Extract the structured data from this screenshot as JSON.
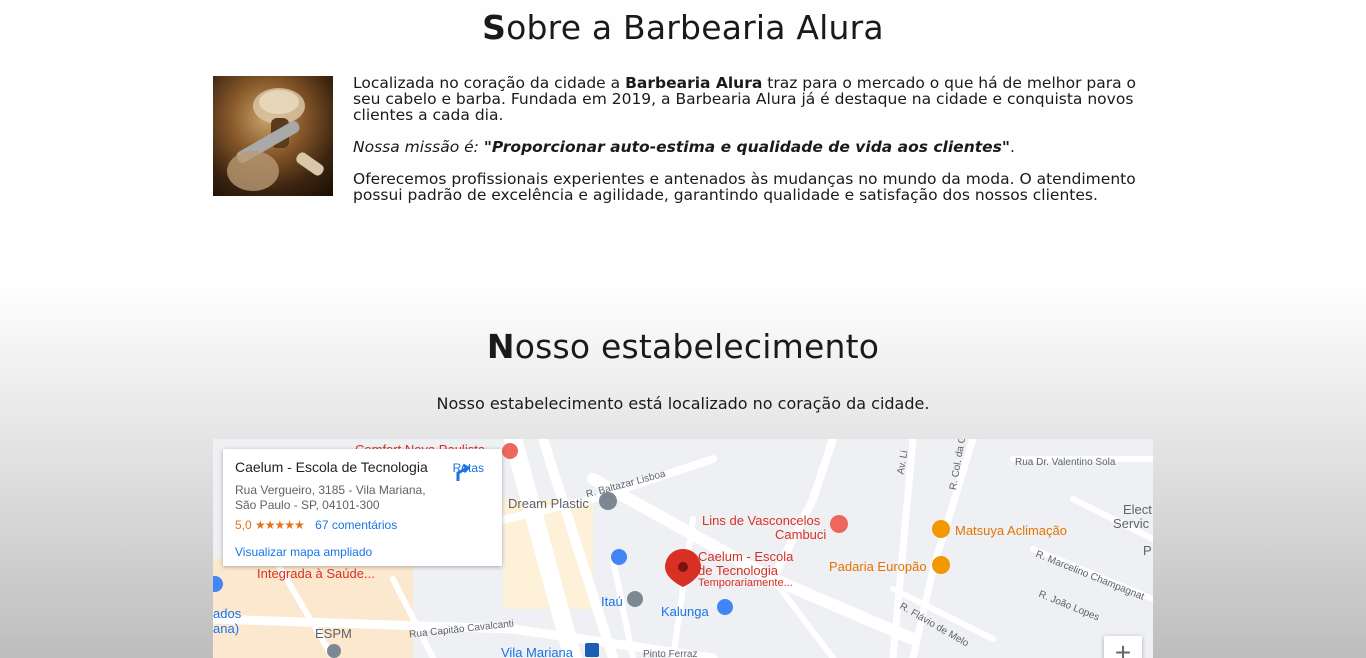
{
  "about": {
    "title_cap": "S",
    "title_rest": "obre a Barbearia Alura",
    "p1_pre": "Localizada no coração da cidade a ",
    "p1_brand": "Barbearia Alura",
    "p1_post": " traz para o mercado o que há de melhor para o seu cabelo e barba. Fundada em 2019, a Barbearia Alura já é destaque na cidade e conquista novos clientes a cada dia.",
    "mission_label": "Nossa missão é: ",
    "mission_quote": "\"Proporcionar auto-estima e qualidade de vida aos clientes\"",
    "mission_end": ".",
    "p3": "Oferecemos profissionais experientes e antenados às mudanças no mundo da moda. O atendimento possui padrão de excelência e agilidade, garantindo qualidade e satisfação dos nossos clientes."
  },
  "store": {
    "title_cap": "N",
    "title_rest": "osso estabelecimento",
    "subtitle": "Nosso estabelecimento está localizado no coração da cidade."
  },
  "map": {
    "card": {
      "name": "Caelum - Escola de Tecnologia",
      "address": "Rua Vergueiro, 3185 - Vila Mariana, São Paulo - SP, 04101-300",
      "rating": "5,0",
      "stars": "★★★★★",
      "reviews": "67 comentários",
      "link": "Visualizar mapa ampliado",
      "directions": "Rotas"
    },
    "labels": {
      "comfort": "Comfort Nova Paulista",
      "baltazar": "R. Baltazar Lisboa",
      "av": "Av. Li",
      "valentino": "Rua Dr. Valentino Sola",
      "dream": "Dream Plastic",
      "lins1": "Lins de Vasconcelos",
      "lins2": "Cambuci",
      "matsuya": "Matsuya Aclimação",
      "elect1": "Elect",
      "elect2": "Servic",
      "gloria": "R. Col. da Glória",
      "caelum1": "Caelum - Escola",
      "caelum2": "de Tecnologia",
      "caelum3": "Temporariamente...",
      "padaria": "Padaria Europão",
      "marcelino": "R. Marcelino Champagnat",
      "integrada": "Integrada à Saúde...",
      "ados": "ados",
      "ana": "ana)",
      "itau": "Itaú",
      "kalunga": "Kalunga",
      "flavio": "R. Flávio de Melo",
      "joao": "R. João Lopes",
      "espm": "ESPM",
      "capitao": "Rua Capitão Cavalcanti",
      "vila": "Vila Mariana",
      "pinto": "Pinto Ferraz",
      "p": "P"
    },
    "zoom_in": "+"
  }
}
